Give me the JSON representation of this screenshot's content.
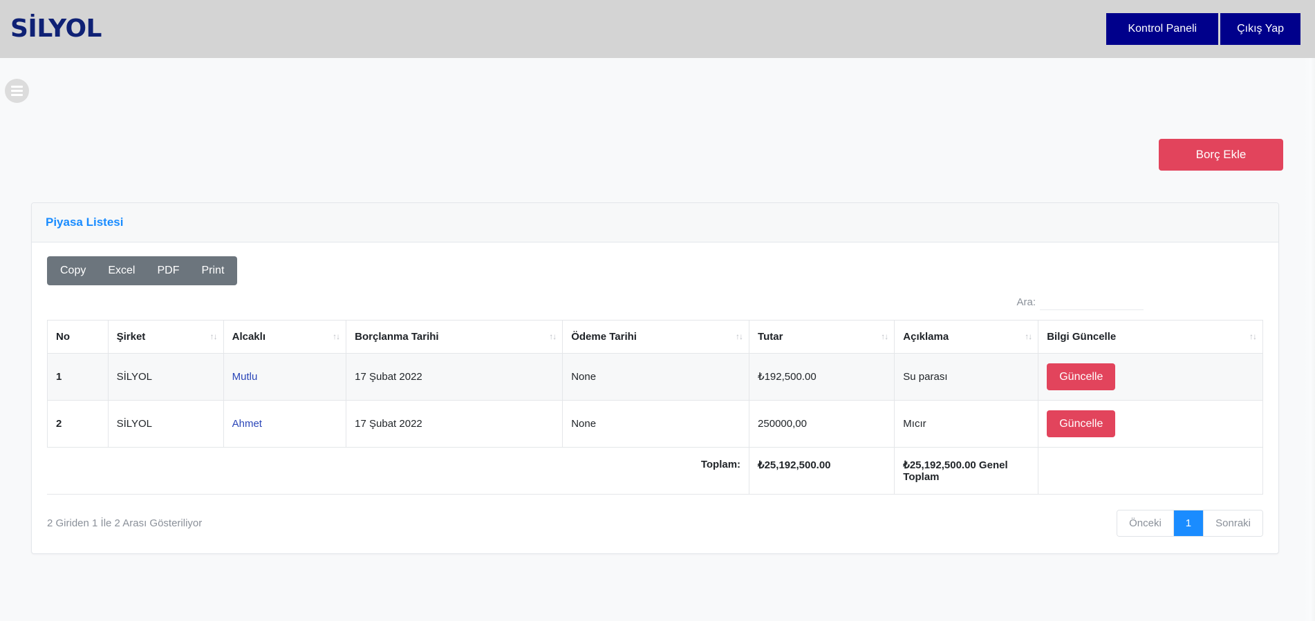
{
  "navbar": {
    "brand": "SİLYOL",
    "buttons": [
      {
        "label": "Kontrol Paneli",
        "name": "kontrol-paneli-button"
      },
      {
        "label": "Çıkış Yap",
        "name": "cikis-yap-button"
      }
    ],
    "background_color": "#d4d4d4",
    "button_color": "#00008b",
    "brand_color": "#0f2175"
  },
  "toolbar": {
    "menu_icon": "hamburger-icon",
    "add_debt_label": "Borç Ekle",
    "add_debt_color": "#e2445c"
  },
  "card": {
    "title": "Piyasa Listesi",
    "title_color": "#1a8cff"
  },
  "export_buttons": [
    {
      "label": "Copy"
    },
    {
      "label": "Excel"
    },
    {
      "label": "PDF"
    },
    {
      "label": "Print"
    }
  ],
  "search": {
    "label": "Ara:",
    "value": "",
    "placeholder": ""
  },
  "table": {
    "columns": [
      {
        "label": "No",
        "sortable": false
      },
      {
        "label": "Şirket",
        "sortable": true
      },
      {
        "label": "Alcaklı",
        "sortable": true
      },
      {
        "label": "Borçlanma Tarihi",
        "sortable": true
      },
      {
        "label": "Ödeme Tarihi",
        "sortable": true
      },
      {
        "label": "Tutar",
        "sortable": true
      },
      {
        "label": "Açıklama",
        "sortable": true
      },
      {
        "label": "Bilgi Güncelle",
        "sortable": true
      }
    ],
    "rows": [
      {
        "no": "1",
        "sirket": "SİLYOL",
        "alacakli": "Mutlu",
        "borclanma_tarihi": "17 Şubat 2022",
        "odeme_tarihi": "None",
        "tutar": "₺192,500.00",
        "aciklama": "Su parası",
        "action_label": "Güncelle"
      },
      {
        "no": "2",
        "sirket": "SİLYOL",
        "alacakli": "Ahmet",
        "borclanma_tarihi": "17 Şubat 2022",
        "odeme_tarihi": "None",
        "tutar": "250000,00",
        "aciklama": "Mıcır",
        "action_label": "Güncelle"
      }
    ],
    "footer": {
      "total_label": "Toplam:",
      "total_amount": "₺25,192,500.00",
      "grand_total": "₺25,192,500.00 Genel Toplam"
    }
  },
  "pagination": {
    "info": "2 Giriden 1 İle 2 Arası Gösteriliyor",
    "previous_label": "Önceki",
    "next_label": "Sonraki",
    "pages": [
      {
        "label": "1",
        "active": true
      }
    ],
    "active_color": "#1a8cff"
  }
}
